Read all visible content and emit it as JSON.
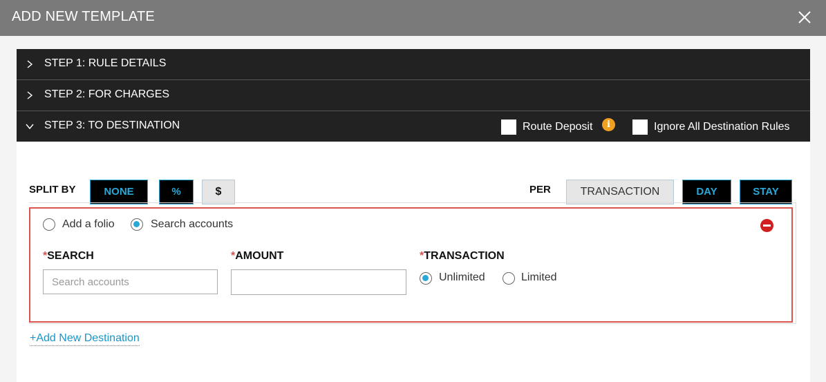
{
  "modal": {
    "title": "ADD NEW TEMPLATE"
  },
  "steps": [
    {
      "label": "STEP 1: RULE DETAILS",
      "state": "collapsed"
    },
    {
      "label": "STEP 2: FOR CHARGES",
      "state": "collapsed"
    },
    {
      "label": "STEP 3: TO DESTINATION",
      "state": "expanded"
    }
  ],
  "step3_options": {
    "route_deposit_label": "Route Deposit",
    "route_deposit_checked": false,
    "ignore_label": "Ignore All Destination Rules",
    "ignore_checked": false,
    "info_glyph": "i"
  },
  "split_by": {
    "label": "SPLIT BY",
    "options": [
      "NONE",
      "%",
      "$"
    ],
    "selected": "$"
  },
  "per": {
    "label": "PER",
    "options": [
      "TRANSACTION",
      "DAY",
      "STAY"
    ],
    "selected": "TRANSACTION"
  },
  "destination": {
    "mode_options": [
      "Add a folio",
      "Search accounts"
    ],
    "mode_selected": "Search accounts",
    "required_mark": "*",
    "search": {
      "label": "SEARCH",
      "placeholder": "Search accounts",
      "value": ""
    },
    "amount": {
      "label": "AMOUNT",
      "value": ""
    },
    "transaction": {
      "label": "TRANSACTION",
      "options": [
        "Unlimited",
        "Limited"
      ],
      "selected": "Unlimited"
    }
  },
  "add_destination_label": "+Add New Destination",
  "colors": {
    "header_bg": "#7a7a7a",
    "step_bg": "#222222",
    "accent": "#29a8d8",
    "error_border": "#d9534f",
    "info": "#f0a020",
    "remove": "#d11f1f"
  }
}
